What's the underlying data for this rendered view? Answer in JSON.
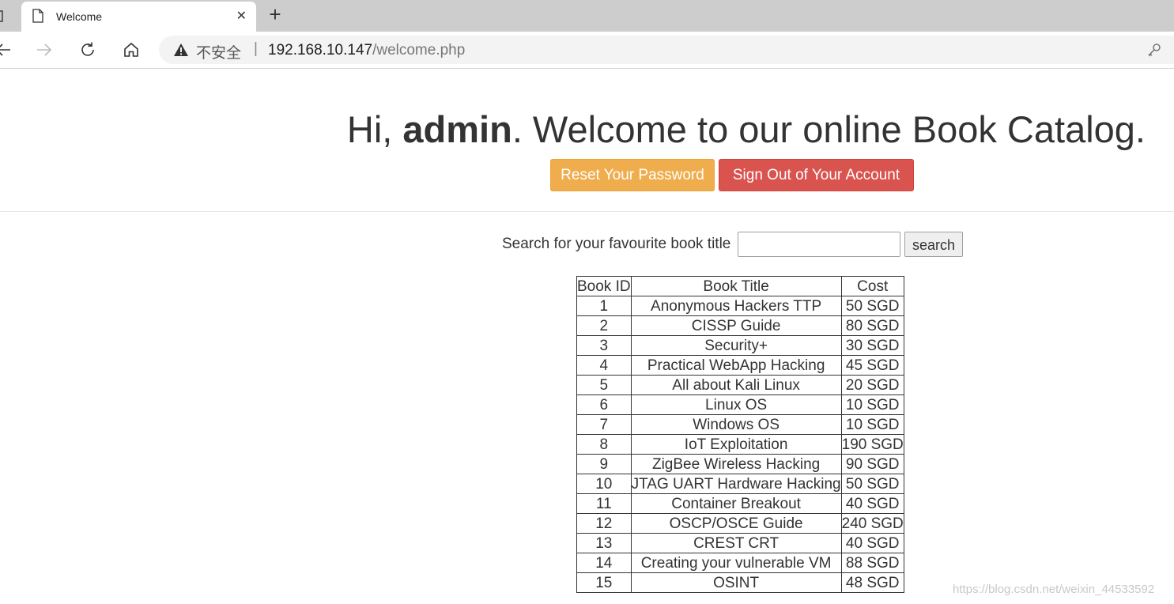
{
  "browser": {
    "tab": {
      "title": "Welcome",
      "close": "✕"
    },
    "new_tab": "+",
    "address": {
      "security_label": "不安全",
      "separator": "|",
      "host": "192.168.10.147",
      "path": "/welcome.php"
    }
  },
  "page": {
    "greeting_prefix": "Hi, ",
    "username": "admin",
    "greeting_suffix": ". Welcome to our online Book Catalog.",
    "reset_button": "Reset Your Password",
    "signout_button": "Sign Out of Your Account",
    "search": {
      "label": "Search for your favourite book title",
      "value": "",
      "button": "search"
    },
    "table": {
      "headers": [
        "Book ID",
        "Book Title",
        "Cost"
      ],
      "rows": [
        [
          "1",
          "Anonymous Hackers TTP",
          "50 SGD"
        ],
        [
          "2",
          "CISSP Guide",
          "80 SGD"
        ],
        [
          "3",
          "Security+",
          "30 SGD"
        ],
        [
          "4",
          "Practical WebApp Hacking",
          "45 SGD"
        ],
        [
          "5",
          "All about Kali Linux",
          "20 SGD"
        ],
        [
          "6",
          "Linux OS",
          "10 SGD"
        ],
        [
          "7",
          "Windows OS",
          "10 SGD"
        ],
        [
          "8",
          "IoT Exploitation",
          "190 SGD"
        ],
        [
          "9",
          "ZigBee Wireless Hacking",
          "90 SGD"
        ],
        [
          "10",
          "JTAG UART Hardware Hacking",
          "50 SGD"
        ],
        [
          "11",
          "Container Breakout",
          "40 SGD"
        ],
        [
          "12",
          "OSCP/OSCE Guide",
          "240 SGD"
        ],
        [
          "13",
          "CREST CRT",
          "40 SGD"
        ],
        [
          "14",
          "Creating your vulnerable VM",
          "88 SGD"
        ],
        [
          "15",
          "OSINT",
          "48 SGD"
        ]
      ]
    },
    "watermark": "https://blog.csdn.net/weixin_44533592"
  },
  "colors": {
    "warning": "#f0ad4e",
    "danger": "#d9534f",
    "text": "#333333",
    "tabbar": "#cdcdcd"
  },
  "icons": [
    "page-icon",
    "close-icon",
    "plus-icon",
    "back-arrow-icon",
    "forward-arrow-icon",
    "reload-icon",
    "home-icon",
    "warning-icon",
    "key-icon"
  ]
}
